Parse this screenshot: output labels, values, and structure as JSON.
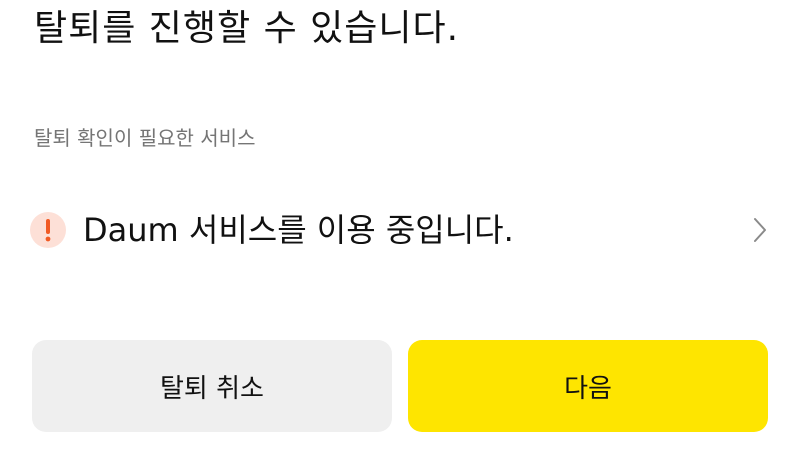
{
  "header": {
    "title": "탈퇴를 진행할 수 있습니다."
  },
  "section": {
    "label": "탈퇴 확인이 필요한 서비스"
  },
  "service_item": {
    "text": "Daum 서비스를 이용 중입니다.",
    "icon": "exclamation-icon",
    "icon_color": "#f15a24",
    "icon_bg": "#fde0d7"
  },
  "buttons": {
    "cancel_label": "탈퇴 취소",
    "next_label": "다음",
    "next_color": "#fee500",
    "cancel_color": "#efefef"
  }
}
